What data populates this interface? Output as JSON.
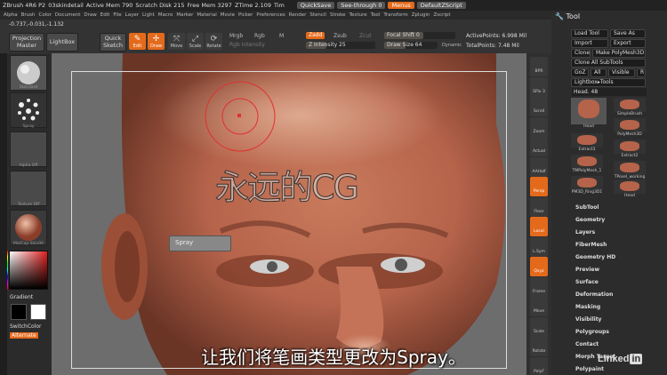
{
  "titlebar": {
    "app": "ZBrush 4R6 P2",
    "doc": "03skindetail",
    "active_mem": "Active Mem 790",
    "scratch": "Scratch Disk 215",
    "free_mem": "Free Mem 3297",
    "ztime": "ZTime 2.109",
    "timer": "Tim",
    "quicksave": "QuickSave",
    "seethrough": "See-through  0",
    "menus": "Menus",
    "script": "DefaultZScript"
  },
  "menubar": [
    "Alpha",
    "Brush",
    "Color",
    "Document",
    "Draw",
    "Edit",
    "File",
    "Layer",
    "Light",
    "Macro",
    "Marker",
    "Material",
    "Movie",
    "Picker",
    "Preferences",
    "Render",
    "Stencil",
    "Stroke",
    "Texture",
    "Tool",
    "Transform",
    "Zplugin",
    "Zscript"
  ],
  "shelf": {
    "coords": "-0.737,-0.031,-1.132",
    "projection_master": "Projection Master",
    "lightbox": "LightBox",
    "quick_sketch": "Quick Sketch",
    "edit": "Edit",
    "draw": "Draw",
    "move": "Move",
    "scale": "Scale",
    "rotate": "Rotate",
    "mrgb": "Mrgb",
    "rgb": "Rgb",
    "m": "M",
    "rgb_intensity": "Rgb Intensity",
    "zadd": "Zadd",
    "zsub": "Zsub",
    "zcut": "Zcut",
    "z_intensity": "Z Intensity 25",
    "focal_shift": "Focal Shift 0",
    "draw_size": "Draw Size 64",
    "dynamic": "Dynamic",
    "active_points": "ActivePoints: 6.998 Mil",
    "total_points": "TotalPoints: 7.48 Mil"
  },
  "left_tray": {
    "standard": "Standard",
    "spray": "Spray",
    "alpha_off": "Alpha Off",
    "texture_off": "Texture Off",
    "matcap": "MatCap Skin06",
    "gradient": "Gradient",
    "switch_color": "SwitchColor",
    "alternate": "Alternate"
  },
  "right_tray": [
    "BPR",
    "SPix 3",
    "Scroll",
    "Zoom",
    "Actual",
    "AAHalf",
    "Persp",
    "Floor",
    "Local",
    "L.Sym",
    "Qxyz",
    "Frame",
    "Move",
    "Scale",
    "Rotate",
    "PolyF"
  ],
  "tool_panel": {
    "title": "Tool",
    "load_tool": "Load Tool",
    "save_as": "Save As",
    "import": "Import",
    "export": "Export",
    "clone": "Clone",
    "make_polymesh": "Make PolyMesh3D",
    "clone_all": "Clone All SubTools",
    "goz": "GoZ",
    "all": "All",
    "visible": "Visible",
    "r": "R",
    "lightbox_tools": "Lightbox▸Tools",
    "head_slider": "Head. 48",
    "thumbs": [
      "Head",
      "SimpleBrush",
      "PolyMesh3D",
      "Extract3",
      "Extract2",
      "TMPolyMesh_1",
      "TPoseI_working",
      "PM3D_Ring3D1",
      "Head"
    ],
    "sections": [
      "SubTool",
      "Geometry",
      "Layers",
      "FiberMesh",
      "Geometry HD",
      "Preview",
      "Surface",
      "Deformation",
      "Masking",
      "Visibility",
      "Polygroups",
      "Contact",
      "Morph Target",
      "Polypaint"
    ]
  },
  "canvas": {
    "tooltip": "Spray",
    "watermark": "永远的CG",
    "subtitle": "让我们将笔画类型更改为Spray。"
  },
  "branding": {
    "linkedin": "Linked",
    "in": "in"
  },
  "colors": {
    "accent": "#e46a1b",
    "face": "#b5634a"
  }
}
